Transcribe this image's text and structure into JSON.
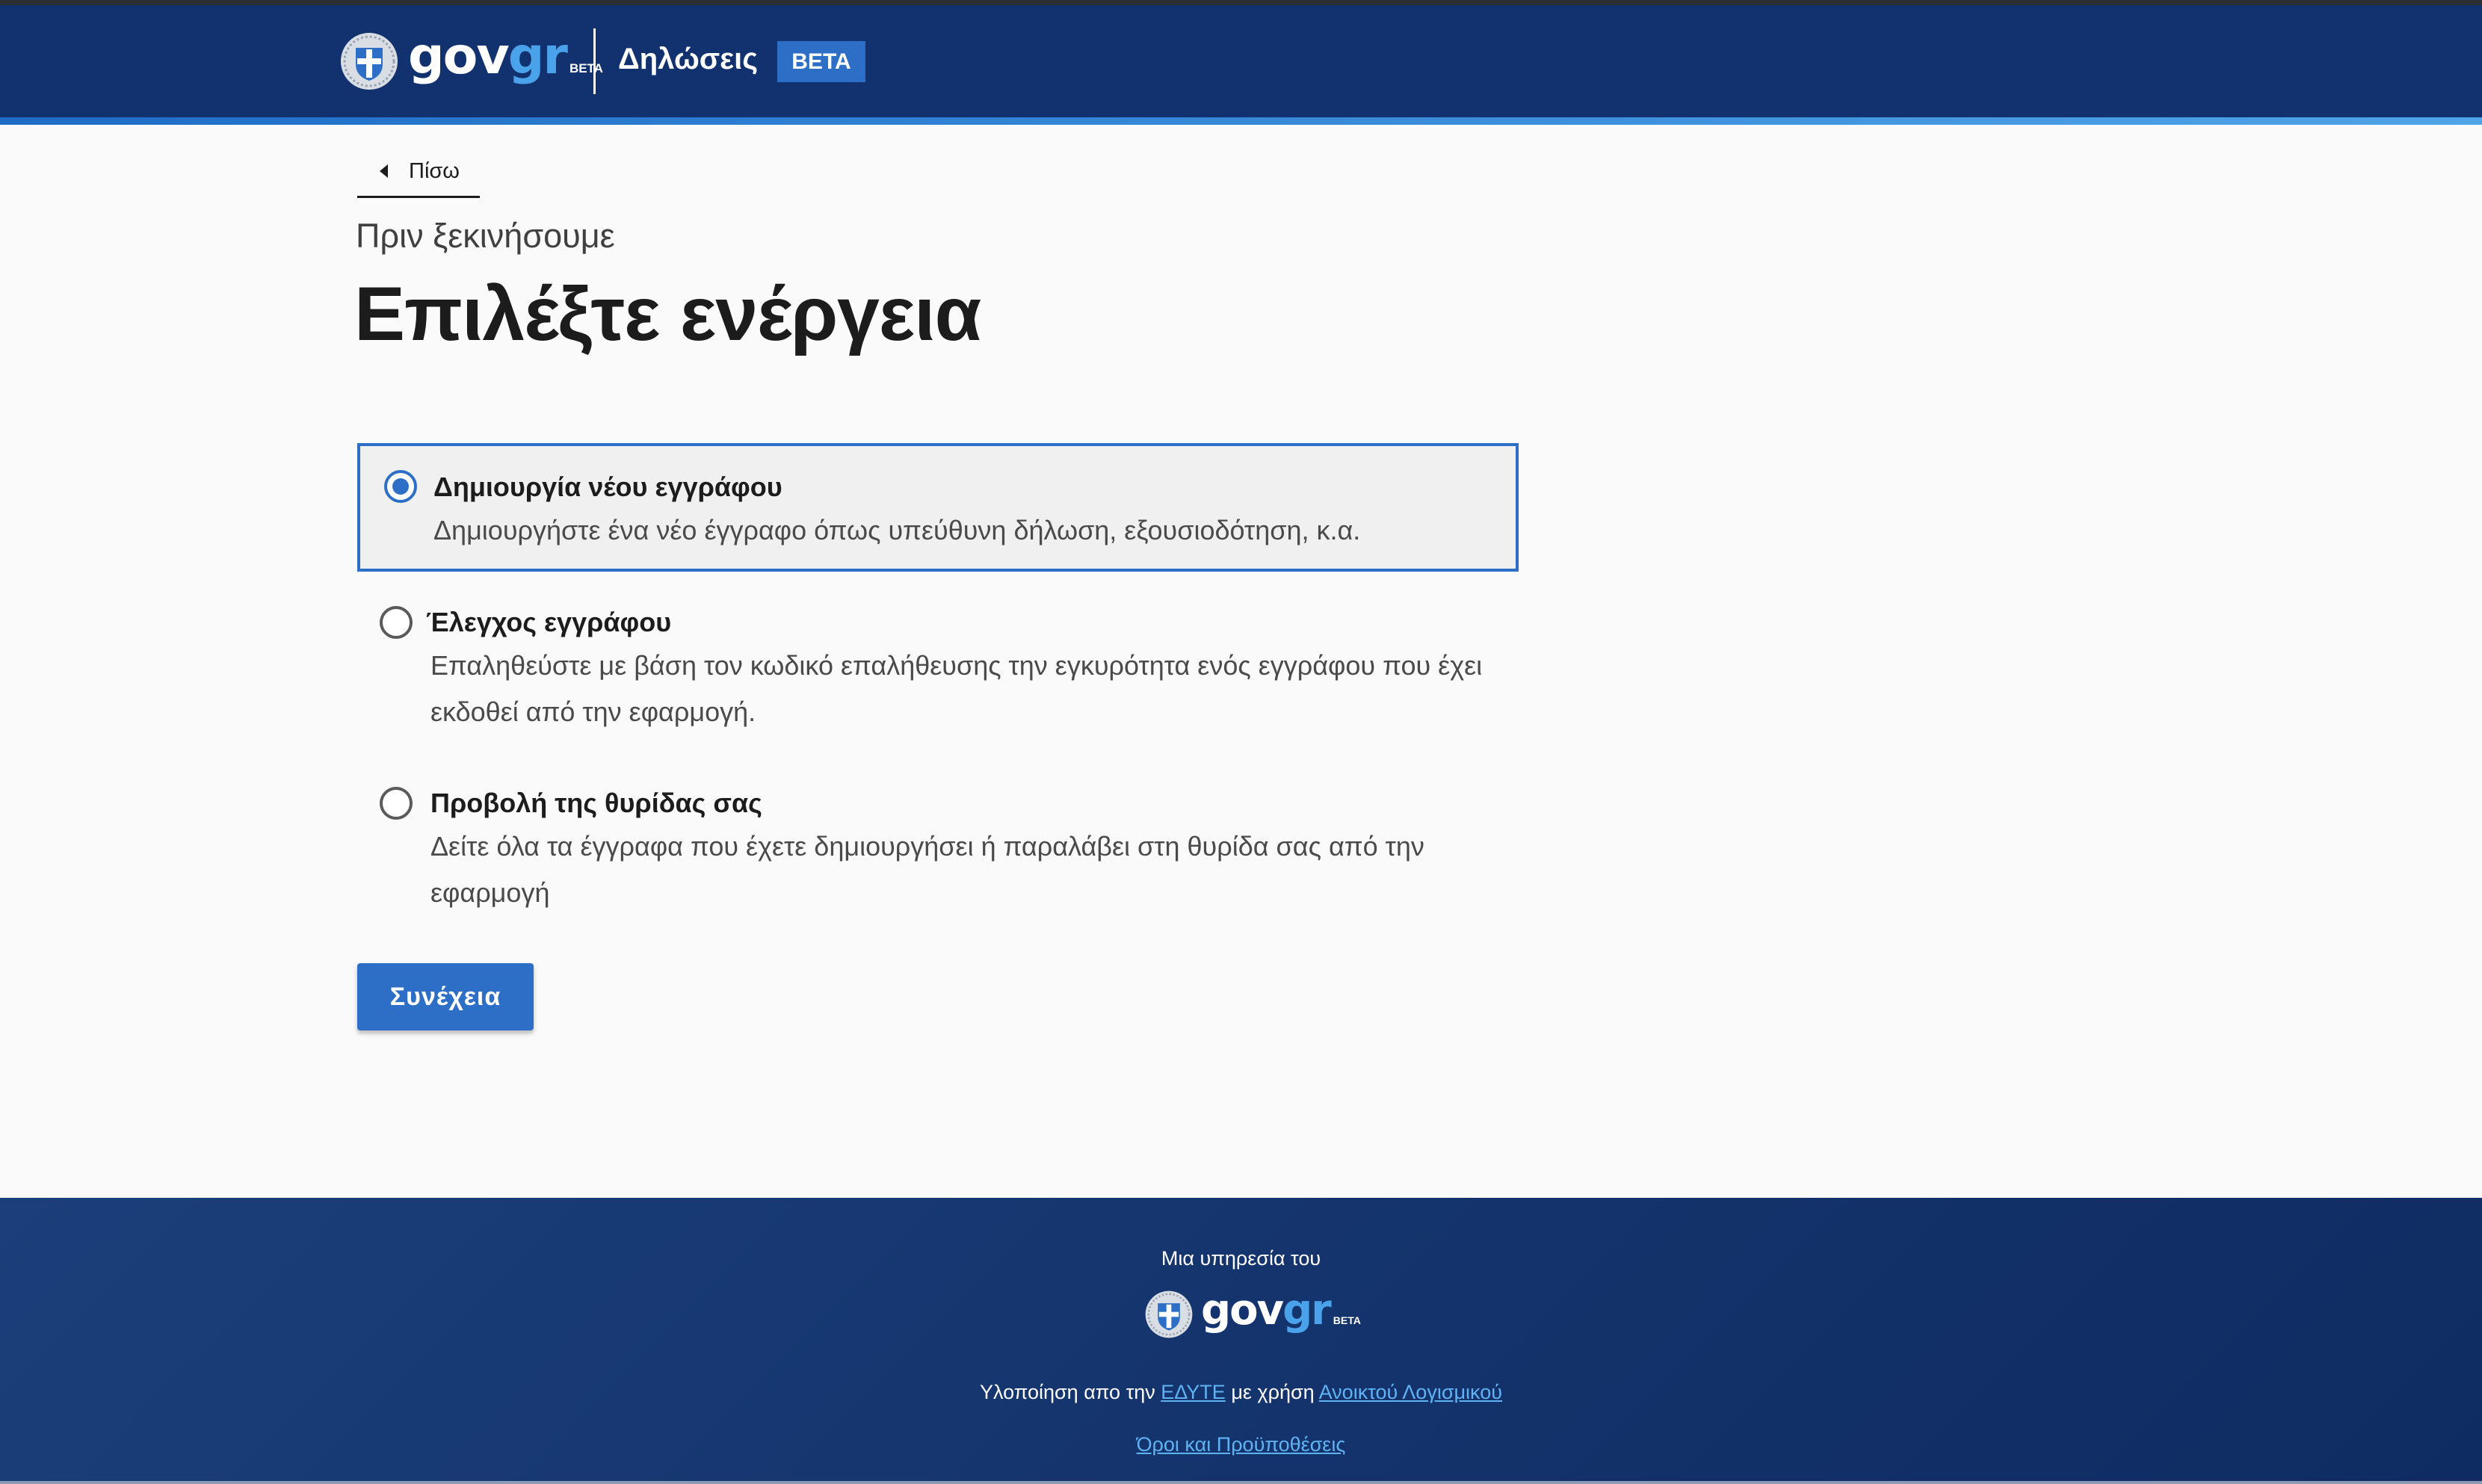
{
  "header": {
    "logo_main": "gov",
    "logo_accent": "gr",
    "logo_beta": "BETA",
    "service_name": "Δηλώσεις",
    "badge": "BETA"
  },
  "back": {
    "label": "Πίσω"
  },
  "caption": "Πριν ξεκινήσουμε",
  "heading": "Επιλέξτε ενέργεια",
  "options": [
    {
      "title": "Δημιουργία νέου εγγράφου",
      "description": "Δημιουργήστε ένα νέο έγγραφο όπως υπεύθυνη δήλωση, εξουσιοδότηση, κ.α.",
      "selected": true
    },
    {
      "title": "Έλεγχος εγγράφου",
      "description": "Επαληθεύστε με βάση τον κωδικό επαλήθευσης την εγκυρότητα ενός εγγράφου που έχει εκδοθεί από την εφαρμογή.",
      "selected": false
    },
    {
      "title": "Προβολή της θυρίδας σας",
      "description": "Δείτε όλα τα έγγραφα που έχετε δημιουργήσει ή παραλάβει στη θυρίδα σας από την εφαρμογή",
      "selected": false
    }
  ],
  "continue_label": "Συνέχεια",
  "footer": {
    "service_of": "Μια υπηρεσία του",
    "logo_main": "gov",
    "logo_accent": "gr",
    "logo_beta": "BETA",
    "impl_prefix": "Υλοποίηση απο την ",
    "impl_org": "ΕΔΥΤΕ",
    "impl_middle": " με χρήση ",
    "impl_software": "Ανοικτού Λογισμικού",
    "terms": "Όροι και Προϋποθέσεις"
  },
  "colors": {
    "header_bg": "#11326f",
    "accent_blue": "#2d6fc7",
    "logo_gr": "#4aa3ea",
    "link": "#5fb3f2",
    "footer_bg": "#14336c"
  },
  "icons": {
    "emblem": "greek-emblem-icon",
    "back": "caret-left-icon"
  }
}
